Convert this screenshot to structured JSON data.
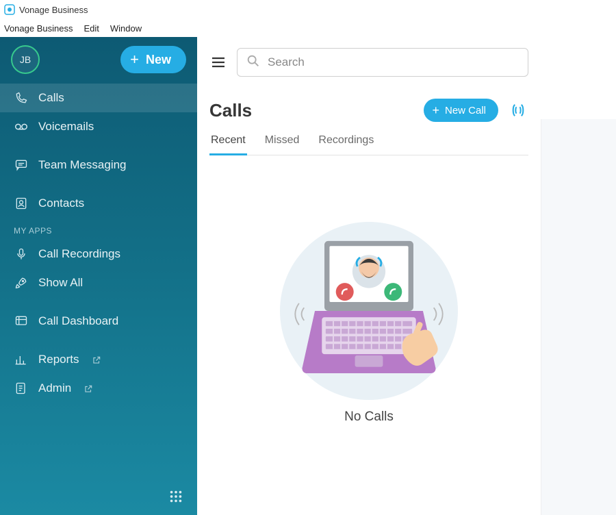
{
  "window": {
    "title": "Vonage Business"
  },
  "menubar": {
    "items": [
      "Vonage Business",
      "Edit",
      "Window"
    ]
  },
  "sidebar": {
    "avatar_initials": "JB",
    "new_button": "New",
    "items": {
      "calls": "Calls",
      "voicemails": "Voicemails",
      "team_messaging": "Team Messaging",
      "contacts": "Contacts"
    },
    "section_label": "MY APPS",
    "my_apps": {
      "call_recordings": "Call Recordings",
      "show_all": "Show All",
      "call_dashboard": "Call Dashboard",
      "reports": "Reports",
      "admin": "Admin"
    }
  },
  "search": {
    "placeholder": "Search"
  },
  "page": {
    "title": "Calls",
    "new_call": "New Call"
  },
  "tabs": {
    "recent": "Recent",
    "missed": "Missed",
    "recordings": "Recordings"
  },
  "empty": {
    "label": "No Calls"
  }
}
